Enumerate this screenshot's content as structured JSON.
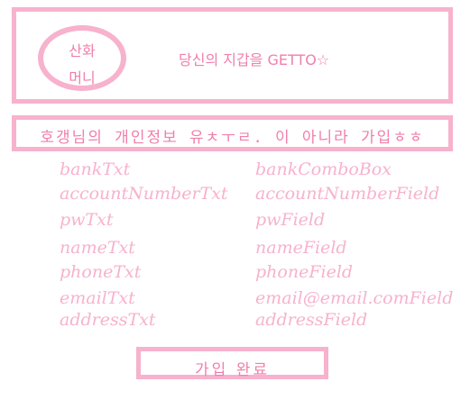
{
  "header": {
    "logo_line1": "산화",
    "logo_line2": "머니",
    "slogan": "당신의 지갑을 GETTO☆"
  },
  "banner": {
    "text": "호갱님의 개인정보 유ㅊㅜㄹ. 이 아니라 가입ㅎㅎ"
  },
  "form": {
    "rows": [
      {
        "label": "bankTxt",
        "field": "bankComboBox"
      },
      {
        "label": "accountNumberTxt",
        "field": "accountNumberField"
      },
      {
        "label": "pwTxt",
        "field": "pwField"
      },
      {
        "label": "nameTxt",
        "field": "nameField"
      },
      {
        "label": "phoneTxt",
        "field": "phoneField"
      },
      {
        "label": "emailTxt",
        "field": "email@email.comField"
      },
      {
        "label": "addressTxt",
        "field": "addressField"
      }
    ]
  },
  "submit": {
    "label": "가입 완료"
  },
  "colors": {
    "border": "#f7b2cd",
    "text": "#f07fac",
    "form_text": "#f7b2cd",
    "background": "#ffffff"
  }
}
